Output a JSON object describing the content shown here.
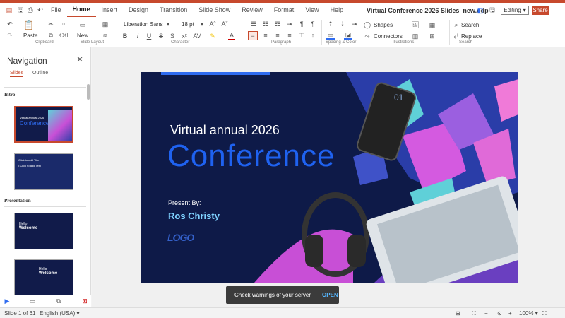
{
  "menubar": {
    "items": [
      "File",
      "Home",
      "Insert",
      "Design",
      "Transition",
      "Slide Show",
      "Review",
      "Format",
      "View",
      "Help"
    ],
    "active": "Home",
    "doc_title": "Virtual Conference 2026 Slides_new.odp",
    "mode": "Editing",
    "share": "Share"
  },
  "ribbon": {
    "groups": [
      "Clipboard",
      "Slide Layout",
      "Character",
      "Paragraph",
      "Spacing & Color",
      "Illustrations",
      "Search"
    ],
    "paste": "Paste",
    "new": "New",
    "font_name": "Liberation Sans",
    "font_size": "18 pt",
    "shapes": "Shapes",
    "connectors": "Connectors",
    "search": "Search",
    "replace": "Replace"
  },
  "nav": {
    "title": "Navigation",
    "tabs": [
      "Slides",
      "Outline"
    ],
    "sections": [
      "Intro",
      "Presentation"
    ],
    "thumbs": [
      {
        "l1": "Virtual annual 2026",
        "l2": "Conference"
      },
      {
        "l1": "Click to add Title",
        "l2": "• Click to add Text"
      },
      {
        "l1": "Hello",
        "l2": "Welcome"
      },
      {
        "l1": "Hello",
        "l2": "Welcome"
      }
    ]
  },
  "slide": {
    "subtitle": "Virtual annual 2026",
    "title": "Conference",
    "present_by": "Present By:",
    "presenter": "Ros Christy",
    "logo": "LOGO",
    "phone_num": "01"
  },
  "toast": {
    "message": "Check warnings of your server",
    "action": "OPEN"
  },
  "status": {
    "slide": "Slide 1 of 61",
    "language": "English (USA)",
    "zoom": "100%"
  }
}
